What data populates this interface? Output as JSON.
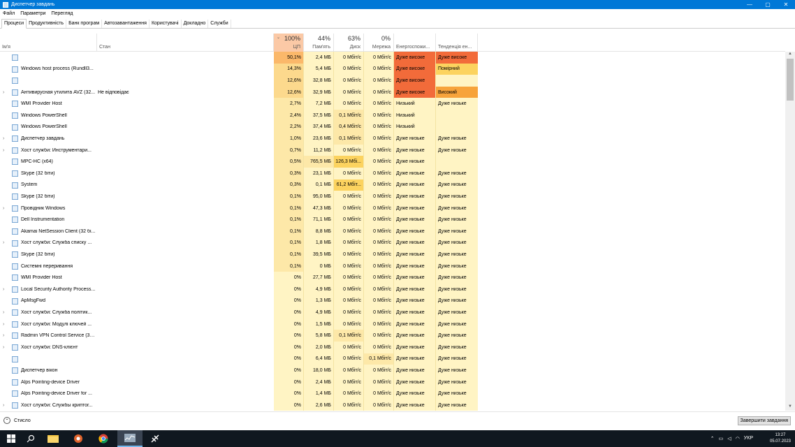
{
  "window": {
    "title": "Диспетчер завдань",
    "min": "—",
    "max": "▢",
    "close": "✕"
  },
  "menu": [
    "Файл",
    "Параметри",
    "Перегляд"
  ],
  "tabs": [
    "Процеси",
    "Продуктивність",
    "Банк програм",
    "Автозавантаження",
    "Користувачі",
    "Докладно",
    "Служби"
  ],
  "header": {
    "name": "Ім'я",
    "status": "Стан",
    "cpu_pct": "100%",
    "cpu": "ЦП",
    "mem_pct": "44%",
    "mem": "Пам'ять",
    "disk_pct": "63%",
    "disk": "Диск",
    "net_pct": "0%",
    "net": "Мережа",
    "energy": "Енергоспожи...",
    "trend": "Тенденція ен..."
  },
  "rows": [
    {
      "exp": "",
      "name": "",
      "status": "",
      "cpu": "50,1%",
      "mem": "2,4 МБ",
      "disk": "0 Мбіт/с",
      "net": "0 Мбіт/с",
      "energy": "Дуже високе",
      "trend": "Дуже високе"
    },
    {
      "exp": "",
      "name": "Windows host process (Rundll3...",
      "status": "",
      "cpu": "14,3%",
      "mem": "5,4 МБ",
      "disk": "0 Мбіт/с",
      "net": "0 Мбіт/с",
      "energy": "Дуже високе",
      "trend": "Помірний"
    },
    {
      "exp": "",
      "name": "",
      "status": "",
      "cpu": "12,6%",
      "mem": "32,8 МБ",
      "disk": "0 Мбіт/с",
      "net": "0 Мбіт/с",
      "energy": "Дуже високе",
      "trend": ""
    },
    {
      "exp": "›",
      "name": "Антивирусная утилита AVZ (32...",
      "status": "Не відповідає",
      "cpu": "12,6%",
      "mem": "32,9 МБ",
      "disk": "0 Мбіт/с",
      "net": "0 Мбіт/с",
      "energy": "Дуже високе",
      "trend": "Високий"
    },
    {
      "exp": "",
      "name": "WMI Provider Host",
      "status": "",
      "cpu": "2,7%",
      "mem": "7,2 МБ",
      "disk": "0 Мбіт/с",
      "net": "0 Мбіт/с",
      "energy": "Низький",
      "trend": "Дуже низьке"
    },
    {
      "exp": "",
      "name": "Windows PowerShell",
      "status": "",
      "cpu": "2,4%",
      "mem": "37,5 МБ",
      "disk": "0,1 Мбіт/с",
      "net": "0 Мбіт/с",
      "energy": "Низький",
      "trend": ""
    },
    {
      "exp": "",
      "name": "Windows PowerShell",
      "status": "",
      "cpu": "2,2%",
      "mem": "37,4 МБ",
      "disk": "0,4 Мбіт/с",
      "net": "0 Мбіт/с",
      "energy": "Низький",
      "trend": ""
    },
    {
      "exp": "›",
      "name": "Диспетчер завдань",
      "status": "",
      "cpu": "1,0%",
      "mem": "23,6 МБ",
      "disk": "0,1 Мбіт/с",
      "net": "0 Мбіт/с",
      "energy": "Дуже низьке",
      "trend": "Дуже низьке"
    },
    {
      "exp": "›",
      "name": "Хост служби: Инструментари...",
      "status": "",
      "cpu": "0,7%",
      "mem": "11,2 МБ",
      "disk": "0 Мбіт/с",
      "net": "0 Мбіт/с",
      "energy": "Дуже низьке",
      "trend": "Дуже низьке"
    },
    {
      "exp": "",
      "name": "MPC-HC (x64)",
      "status": "",
      "cpu": "0,5%",
      "mem": "765,5 МБ",
      "disk": "126,3 Мбі...",
      "net": "0 Мбіт/с",
      "energy": "Дуже низьке",
      "trend": ""
    },
    {
      "exp": "",
      "name": "Skype (32 біти)",
      "status": "",
      "cpu": "0,3%",
      "mem": "23,1 МБ",
      "disk": "0 Мбіт/с",
      "net": "0 Мбіт/с",
      "energy": "Дуже низьке",
      "trend": "Дуже низьке"
    },
    {
      "exp": "",
      "name": "System",
      "status": "",
      "cpu": "0,3%",
      "mem": "0,1 МБ",
      "disk": "61,2 Мбіт...",
      "net": "0 Мбіт/с",
      "energy": "Дуже низьке",
      "trend": "Дуже низьке"
    },
    {
      "exp": "",
      "name": "Skype (32 біти)",
      "status": "",
      "cpu": "0,1%",
      "mem": "95,0 МБ",
      "disk": "0 Мбіт/с",
      "net": "0 Мбіт/с",
      "energy": "Дуже низьке",
      "trend": "Дуже низьке"
    },
    {
      "exp": "›",
      "name": "Провідник Windows",
      "status": "",
      "cpu": "0,1%",
      "mem": "47,3 МБ",
      "disk": "0 Мбіт/с",
      "net": "0 Мбіт/с",
      "energy": "Дуже низьке",
      "trend": "Дуже низьке"
    },
    {
      "exp": "",
      "name": "Dell Instrumentation",
      "status": "",
      "cpu": "0,1%",
      "mem": "71,1 МБ",
      "disk": "0 Мбіт/с",
      "net": "0 Мбіт/с",
      "energy": "Дуже низьке",
      "trend": "Дуже низьке"
    },
    {
      "exp": "",
      "name": "Akamai NetSession Client (32 бі...",
      "status": "",
      "cpu": "0,1%",
      "mem": "8,8 МБ",
      "disk": "0 Мбіт/с",
      "net": "0 Мбіт/с",
      "energy": "Дуже низьке",
      "trend": "Дуже низьке"
    },
    {
      "exp": "›",
      "name": "Хост служби: Служба списку ...",
      "status": "",
      "cpu": "0,1%",
      "mem": "1,8 МБ",
      "disk": "0 Мбіт/с",
      "net": "0 Мбіт/с",
      "energy": "Дуже низьке",
      "trend": "Дуже низьке"
    },
    {
      "exp": "",
      "name": "Skype (32 біти)",
      "status": "",
      "cpu": "0,1%",
      "mem": "39,5 МБ",
      "disk": "0 Мбіт/с",
      "net": "0 Мбіт/с",
      "energy": "Дуже низьке",
      "trend": "Дуже низьке"
    },
    {
      "exp": "",
      "name": "Системні переривання",
      "status": "",
      "cpu": "0,1%",
      "mem": "0 МБ",
      "disk": "0 Мбіт/с",
      "net": "0 Мбіт/с",
      "energy": "Дуже низьке",
      "trend": "Дуже низьке"
    },
    {
      "exp": "",
      "name": "WMI Provider Host",
      "status": "",
      "cpu": "0%",
      "mem": "27,7 МБ",
      "disk": "0 Мбіт/с",
      "net": "0 Мбіт/с",
      "energy": "Дуже низьке",
      "trend": "Дуже низьке"
    },
    {
      "exp": "›",
      "name": "Local Security Authority Process...",
      "status": "",
      "cpu": "0%",
      "mem": "4,9 МБ",
      "disk": "0 Мбіт/с",
      "net": "0 Мбіт/с",
      "energy": "Дуже низьке",
      "trend": "Дуже низьке"
    },
    {
      "exp": "",
      "name": "ApMsgFwd",
      "status": "",
      "cpu": "0%",
      "mem": "1,3 МБ",
      "disk": "0 Мбіт/с",
      "net": "0 Мбіт/с",
      "energy": "Дуже низьке",
      "trend": "Дуже низьке"
    },
    {
      "exp": "›",
      "name": "Хост служби: Служба політик...",
      "status": "",
      "cpu": "0%",
      "mem": "4,9 МБ",
      "disk": "0 Мбіт/с",
      "net": "0 Мбіт/с",
      "energy": "Дуже низьке",
      "trend": "Дуже низьке"
    },
    {
      "exp": "›",
      "name": "Хост служби: Модулі ключей ...",
      "status": "",
      "cpu": "0%",
      "mem": "1,5 МБ",
      "disk": "0 Мбіт/с",
      "net": "0 Мбіт/с",
      "energy": "Дуже низьке",
      "trend": "Дуже низьке"
    },
    {
      "exp": "›",
      "name": "Radmin VPN Control Service (32...",
      "status": "",
      "cpu": "0%",
      "mem": "5,8 МБ",
      "disk": "0,1 Мбіт/с",
      "net": "0 Мбіт/с",
      "energy": "Дуже низьке",
      "trend": "Дуже низьке"
    },
    {
      "exp": "›",
      "name": "Хост служби: DNS-клієнт",
      "status": "",
      "cpu": "0%",
      "mem": "2,0 МБ",
      "disk": "0 Мбіт/с",
      "net": "0 Мбіт/с",
      "energy": "Дуже низьке",
      "trend": "Дуже низьке"
    },
    {
      "exp": "",
      "name": "",
      "status": "",
      "cpu": "0%",
      "mem": "6,4 МБ",
      "disk": "0 Мбіт/с",
      "net": "0,1 Мбіт/с",
      "energy": "Дуже низьке",
      "trend": "Дуже низьке"
    },
    {
      "exp": "",
      "name": "Диспетчер вікон",
      "status": "",
      "cpu": "0%",
      "mem": "18,0 МБ",
      "disk": "0 Мбіт/с",
      "net": "0 Мбіт/с",
      "energy": "Дуже низьке",
      "trend": "Дуже низьке"
    },
    {
      "exp": "",
      "name": "Alps Pointing-device Driver",
      "status": "",
      "cpu": "0%",
      "mem": "2,4 МБ",
      "disk": "0 Мбіт/с",
      "net": "0 Мбіт/с",
      "energy": "Дуже низьке",
      "trend": "Дуже низьке"
    },
    {
      "exp": "",
      "name": "Alps Pointing-device Driver for ...",
      "status": "",
      "cpu": "0%",
      "mem": "1,4 МБ",
      "disk": "0 Мбіт/с",
      "net": "0 Мбіт/с",
      "energy": "Дуже низьке",
      "trend": "Дуже низьке"
    },
    {
      "exp": "›",
      "name": "Хост служби: Службы криптог...",
      "status": "",
      "cpu": "0%",
      "mem": "2,6 МБ",
      "disk": "0 Мбіт/с",
      "net": "0 Мбіт/с",
      "energy": "Дуже низьке",
      "trend": "Дуже низьке"
    }
  ],
  "footer": {
    "fewer": "Стисло",
    "end_task": "Завершити завдання"
  },
  "taskbar": {
    "lang": "УКР",
    "time": "13:27",
    "date": "05.07.2023"
  },
  "colors": {
    "titlebar": "#0078d7",
    "cpu_high": "#fbb86a",
    "very_high": "#f26b3a",
    "high": "#f7a33b",
    "moderate": "#fcd35f",
    "light": "#fff4c4",
    "cell_base": "#fff4c4"
  }
}
